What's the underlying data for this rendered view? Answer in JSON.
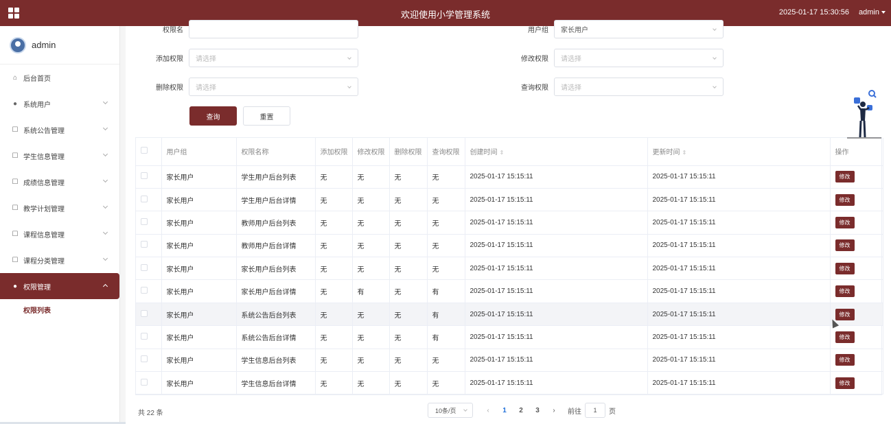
{
  "header": {
    "title": "欢迎使用小学管理系统",
    "datetime": "2025-01-17 15:30:56",
    "user": "admin"
  },
  "sidebar": {
    "profile_name": "admin",
    "items": [
      {
        "label": "后台首页",
        "icon": "home-icon"
      },
      {
        "label": "系统用户",
        "icon": "user-icon"
      },
      {
        "label": "系统公告管理",
        "icon": "edit-icon"
      },
      {
        "label": "学生信息管理",
        "icon": "edit-icon"
      },
      {
        "label": "成绩信息管理",
        "icon": "edit-icon"
      },
      {
        "label": "教学计划管理",
        "icon": "edit-icon"
      },
      {
        "label": "课程信息管理",
        "icon": "edit-icon"
      },
      {
        "label": "课程分类管理",
        "icon": "edit-icon"
      },
      {
        "label": "权限管理",
        "icon": "user-icon"
      }
    ],
    "sub_item": "权限列表"
  },
  "filters": {
    "perm_name_label": "权限名",
    "perm_name_value": "",
    "user_group_label": "用户组",
    "user_group_value": "家长用户",
    "add_label": "添加权限",
    "edit_label": "修改权限",
    "delete_label": "删除权限",
    "query_label": "查询权限",
    "placeholder": "请选择",
    "search_button": "查询",
    "reset_button": "重置"
  },
  "table": {
    "headers": [
      "用户组",
      "权限名称",
      "添加权限",
      "修改权限",
      "删除权限",
      "查询权限",
      "创建时间",
      "更新时间",
      "操作"
    ],
    "sort_symbol": "⇕",
    "edit_label": "修改",
    "rows": [
      [
        "家长用户",
        "学生用户后台列表",
        "无",
        "无",
        "无",
        "无",
        "2025-01-17 15:15:11",
        "2025-01-17 15:15:11"
      ],
      [
        "家长用户",
        "学生用户后台详情",
        "无",
        "无",
        "无",
        "无",
        "2025-01-17 15:15:11",
        "2025-01-17 15:15:11"
      ],
      [
        "家长用户",
        "教师用户后台列表",
        "无",
        "无",
        "无",
        "无",
        "2025-01-17 15:15:11",
        "2025-01-17 15:15:11"
      ],
      [
        "家长用户",
        "教师用户后台详情",
        "无",
        "无",
        "无",
        "无",
        "2025-01-17 15:15:11",
        "2025-01-17 15:15:11"
      ],
      [
        "家长用户",
        "家长用户后台列表",
        "无",
        "无",
        "无",
        "无",
        "2025-01-17 15:15:11",
        "2025-01-17 15:15:11"
      ],
      [
        "家长用户",
        "家长用户后台详情",
        "无",
        "有",
        "无",
        "有",
        "2025-01-17 15:15:11",
        "2025-01-17 15:15:11"
      ],
      [
        "家长用户",
        "系统公告后台列表",
        "无",
        "无",
        "无",
        "有",
        "2025-01-17 15:15:11",
        "2025-01-17 15:15:11"
      ],
      [
        "家长用户",
        "系统公告后台详情",
        "无",
        "无",
        "无",
        "有",
        "2025-01-17 15:15:11",
        "2025-01-17 15:15:11"
      ],
      [
        "家长用户",
        "学生信息后台列表",
        "无",
        "无",
        "无",
        "无",
        "2025-01-17 15:15:11",
        "2025-01-17 15:15:11"
      ],
      [
        "家长用户",
        "学生信息后台详情",
        "无",
        "无",
        "无",
        "无",
        "2025-01-17 15:15:11",
        "2025-01-17 15:15:11"
      ]
    ]
  },
  "pagination": {
    "total": "共 22 条",
    "page_size": "10条/页",
    "pages": [
      "1",
      "2",
      "3"
    ],
    "current": "1",
    "goto_label": "前往",
    "goto_value": "1",
    "page_unit": "页"
  },
  "colors": {
    "brand": "#7a2c2c",
    "active_page": "#1e6fd9"
  }
}
